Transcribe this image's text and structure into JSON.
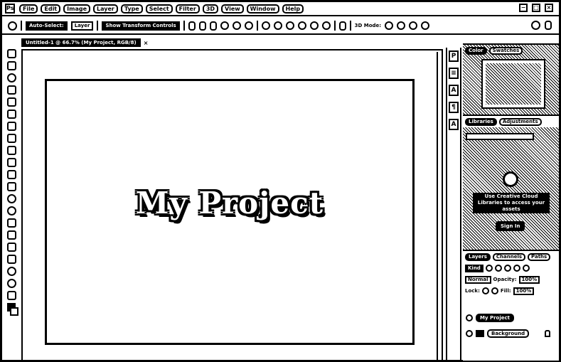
{
  "menu": {
    "app_icon": "Ps",
    "items": [
      "File",
      "Edit",
      "Image",
      "Layer",
      "Type",
      "Select",
      "Filter",
      "3D",
      "View",
      "Window",
      "Help"
    ]
  },
  "window_controls": [
    "−",
    "□",
    "×"
  ],
  "options": {
    "auto_select_label": "Auto-Select:",
    "layer_dropdown": "Layer",
    "transform_label": "Show Transform Controls",
    "mode_label": "3D Mode:"
  },
  "document_tab": {
    "title": "Untitled-1 @ 66.7% (My Project, RGB/8)",
    "close": "×"
  },
  "canvas": {
    "title_text": "My Project"
  },
  "dock_buttons": [
    "P",
    "≡",
    "A",
    "¶",
    "A"
  ],
  "navigator_panel": {
    "tabs": [
      "Color",
      "Swatches"
    ]
  },
  "libraries_panel": {
    "tabs": [
      "Libraries",
      "Adjustments"
    ],
    "message": "Use Creative Cloud Libraries to access your assets",
    "button": "Sign In"
  },
  "layers_panel": {
    "tabs": [
      "Layers",
      "Channels",
      "Paths"
    ],
    "filter_label": "Kind",
    "blend_mode": "Normal",
    "opacity_label": "Opacity:",
    "opacity_value": "100%",
    "fill_label": "Fill:",
    "fill_value": "100%",
    "lock_label": "Lock:",
    "layers": [
      {
        "name": "My Project",
        "type": "text"
      },
      {
        "name": "Background",
        "type": "raster"
      }
    ]
  }
}
